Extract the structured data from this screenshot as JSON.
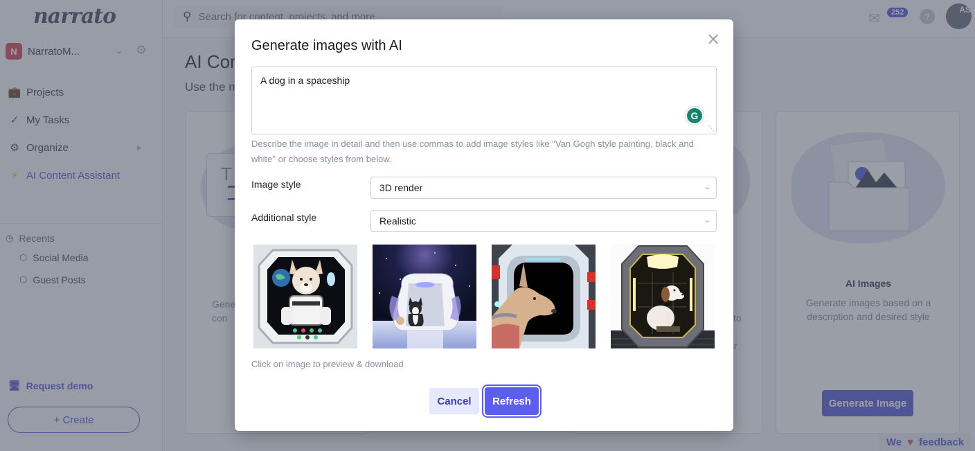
{
  "app": {
    "logo": "narrato",
    "org": {
      "initial": "N",
      "name": "NarratoM...",
      "badge_color": "#d9475a"
    },
    "nav": [
      {
        "label": "Projects",
        "icon": "briefcase-icon"
      },
      {
        "label": "My Tasks",
        "icon": "double-check-icon"
      },
      {
        "label": "Organize",
        "icon": "gears-icon"
      },
      {
        "label": "AI Content Assistant",
        "icon": "lightning-icon",
        "active": true
      }
    ],
    "recents": {
      "heading": "Recents",
      "items": [
        {
          "label": "Social Media"
        },
        {
          "label": "Guest Posts"
        }
      ]
    },
    "request_demo": "Request demo",
    "create": "+ Create",
    "accent_color": "#5b5bd6"
  },
  "topbar": {
    "search_placeholder": "Search for content, projects, and more",
    "mail_count": "252",
    "help": "?",
    "avatar_initials": "AS"
  },
  "page": {
    "title": "AI Content Assistant",
    "subtitle": "Use the most powerful AI content tools",
    "cards": [
      {
        "desc_fragment": "Gene\ncon"
      },
      {
        "desc_fragment": "e\ns to\na\nfor"
      },
      {
        "title": "AI Images",
        "desc": "Generate images based on a description and desired style",
        "button": "Generate Image"
      }
    ],
    "feedback": {
      "prefix": "We",
      "heart": "♥",
      "suffix": "feedback"
    }
  },
  "modal": {
    "title": "Generate images with AI",
    "close": "×",
    "prompt_value": "A dog in a spaceship",
    "grammarly_icon": "G",
    "help_text": "Describe the image in detail and then use commas to add image styles like \"Van Gogh style painting, black and white\" or choose styles from below.",
    "image_style": {
      "label": "Image style",
      "value": "3D render"
    },
    "additional_style": {
      "label": "Additional style",
      "value": "Realistic"
    },
    "images": [
      {
        "alt": "Husky dog in astronaut suit at spaceship window"
      },
      {
        "alt": "Husky sitting in white space pod against galaxy"
      },
      {
        "alt": "Tan dog looking out spaceship porthole"
      },
      {
        "alt": "White dog seated inside hexagonal capsule"
      }
    ],
    "gallery_note": "Click on image to preview & download",
    "cancel": "Cancel",
    "refresh": "Refresh",
    "primary_color": "#5b5ef0"
  }
}
